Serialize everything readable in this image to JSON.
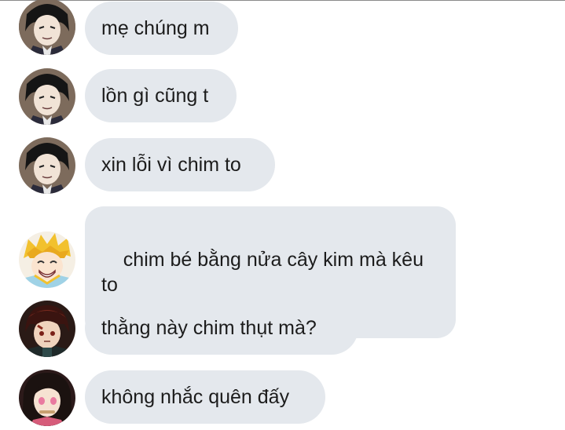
{
  "messages": [
    {
      "avatar": "man-dark-hair-avatar",
      "text": "mẹ chúng m"
    },
    {
      "avatar": "man-dark-hair-avatar",
      "text": "lồn gì cũng t"
    },
    {
      "avatar": "man-dark-hair-avatar",
      "text": "xin lỗi vì chim to"
    },
    {
      "avatar": "blonde-boy-avatar",
      "text": "chim bé bằng nửa cây kim mà kêu to"
    },
    {
      "avatar": "scarred-boy-avatar",
      "text": "thằng này chim thụt mà?"
    },
    {
      "avatar": "girl-bamboo-avatar",
      "text": "không nhắc quên đấy"
    }
  ],
  "colors": {
    "bubble": "#e4e8ed",
    "text": "#1c1c1c",
    "background": "#ffffff"
  }
}
